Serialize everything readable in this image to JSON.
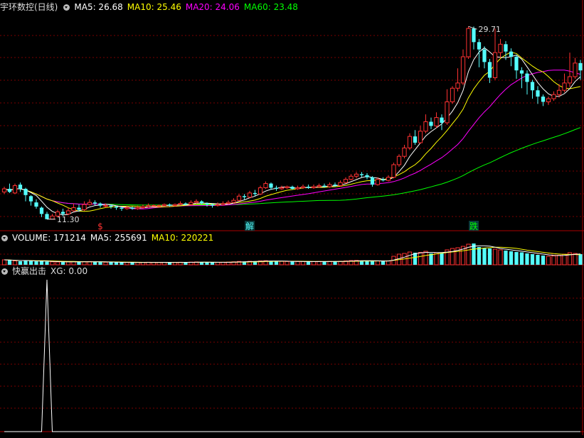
{
  "colors": {
    "up": "#ff3232",
    "down": "#54fcfc",
    "ma5": "#ffffff",
    "ma10": "#ffff00",
    "ma20": "#ff00ff",
    "ma60": "#00ff00",
    "grid": "#7a0000",
    "border": "#aa0000"
  },
  "header": {
    "title": "宇环数控(日线)",
    "ma5": "MA5: 26.68",
    "ma10": "MA10: 25.46",
    "ma20": "MA20: 24.06",
    "ma60": "MA60: 23.48"
  },
  "volume_header": {
    "label": "VOLUME: 171214",
    "ma5": "MA5: 255691",
    "ma10": "MA10: 220221"
  },
  "indicator_header": {
    "title": "快赢出击",
    "xg": "XG: 0.00"
  },
  "chart_data": [
    {
      "type": "candlestick",
      "title": "宇环数控(日线)",
      "price_range": [
        10.2,
        31.0
      ],
      "annotations": [
        {
          "text": "29.71",
          "kind": "high"
        },
        {
          "text": "11.30",
          "kind": "low"
        }
      ],
      "markers": [
        {
          "text": "$",
          "color": "#ff3232"
        },
        {
          "text": "解",
          "color": "#54fcfc"
        },
        {
          "text": "跌",
          "color": "#00ff00"
        }
      ],
      "candles": [
        [
          13.9,
          14.2,
          14.4,
          13.7
        ],
        [
          14.2,
          13.9,
          14.7,
          13.8
        ],
        [
          13.8,
          14.5,
          14.7,
          13.7
        ],
        [
          14.6,
          14.2,
          14.8,
          13.9
        ],
        [
          14.2,
          13.6,
          14.3,
          13.0
        ],
        [
          13.5,
          13.0,
          13.6,
          12.6
        ],
        [
          12.9,
          12.5,
          13.2,
          12.3
        ],
        [
          12.4,
          11.8,
          12.5,
          11.5
        ],
        [
          11.8,
          11.3,
          12.0,
          11.3
        ],
        [
          11.3,
          11.6,
          11.8,
          11.3
        ],
        [
          11.6,
          12.0,
          12.2,
          11.5
        ],
        [
          12.0,
          11.8,
          12.3,
          11.6
        ],
        [
          11.8,
          12.1,
          12.4,
          11.7
        ],
        [
          12.1,
          12.4,
          12.8,
          12.0
        ],
        [
          12.4,
          12.2,
          12.7,
          12.0
        ],
        [
          12.2,
          12.7,
          13.0,
          12.1
        ],
        [
          12.7,
          12.9,
          13.2,
          12.6
        ],
        [
          12.9,
          12.8,
          13.1,
          12.6
        ],
        [
          12.8,
          12.6,
          12.9,
          12.4
        ],
        [
          12.6,
          12.6,
          12.8,
          12.4
        ],
        [
          12.6,
          12.5,
          12.7,
          12.3
        ],
        [
          12.5,
          12.4,
          12.6,
          12.2
        ],
        [
          12.4,
          12.3,
          12.5,
          12.1
        ],
        [
          12.3,
          12.4,
          12.6,
          12.2
        ],
        [
          12.4,
          12.3,
          12.5,
          12.2
        ],
        [
          12.3,
          12.4,
          12.6,
          12.2
        ],
        [
          12.4,
          12.5,
          12.7,
          12.3
        ],
        [
          12.5,
          12.6,
          12.8,
          12.4
        ],
        [
          12.6,
          12.6,
          12.7,
          12.5
        ],
        [
          12.6,
          12.6,
          12.7,
          12.5
        ],
        [
          12.6,
          12.7,
          12.8,
          12.5
        ],
        [
          12.7,
          12.6,
          12.8,
          12.5
        ],
        [
          12.6,
          12.7,
          12.8,
          12.5
        ],
        [
          12.7,
          12.8,
          13.0,
          12.6
        ],
        [
          12.8,
          12.7,
          12.9,
          12.6
        ],
        [
          12.7,
          12.9,
          13.1,
          12.6
        ],
        [
          12.9,
          13.0,
          13.2,
          12.8
        ],
        [
          13.0,
          12.8,
          13.1,
          12.7
        ],
        [
          12.8,
          12.7,
          12.9,
          12.5
        ],
        [
          12.7,
          12.6,
          12.8,
          12.4
        ],
        [
          12.6,
          12.7,
          12.9,
          12.5
        ],
        [
          12.7,
          12.8,
          13.0,
          12.6
        ],
        [
          12.8,
          12.9,
          13.1,
          12.7
        ],
        [
          12.9,
          13.1,
          13.3,
          12.8
        ],
        [
          13.1,
          13.5,
          13.7,
          13.0
        ],
        [
          13.5,
          13.4,
          13.7,
          13.2
        ],
        [
          13.4,
          13.8,
          14.0,
          13.3
        ],
        [
          13.8,
          13.7,
          14.1,
          13.5
        ],
        [
          13.7,
          14.3,
          14.5,
          13.6
        ],
        [
          14.3,
          14.7,
          14.9,
          14.2
        ],
        [
          14.7,
          14.3,
          14.8,
          14.1
        ],
        [
          14.3,
          14.2,
          14.5,
          14.0
        ],
        [
          14.2,
          14.3,
          14.5,
          14.1
        ],
        [
          14.3,
          14.4,
          14.5,
          14.2
        ],
        [
          14.4,
          14.2,
          14.5,
          14.1
        ],
        [
          14.2,
          14.3,
          14.5,
          14.1
        ],
        [
          14.3,
          14.4,
          14.6,
          14.2
        ],
        [
          14.4,
          14.3,
          14.6,
          14.2
        ],
        [
          14.3,
          14.4,
          14.6,
          14.2
        ],
        [
          14.4,
          14.5,
          14.7,
          14.3
        ],
        [
          14.5,
          14.4,
          14.7,
          14.3
        ],
        [
          14.4,
          14.6,
          14.8,
          14.3
        ],
        [
          14.6,
          14.5,
          14.8,
          14.4
        ],
        [
          14.5,
          14.8,
          15.0,
          14.4
        ],
        [
          14.8,
          15.1,
          15.3,
          14.7
        ],
        [
          15.1,
          15.4,
          15.6,
          15.0
        ],
        [
          15.4,
          15.6,
          15.8,
          15.2
        ],
        [
          15.6,
          15.5,
          15.8,
          15.3
        ],
        [
          15.5,
          15.3,
          15.7,
          15.1
        ],
        [
          15.3,
          14.6,
          15.4,
          14.4
        ],
        [
          14.6,
          15.1,
          15.3,
          14.5
        ],
        [
          15.1,
          15.0,
          15.3,
          14.9
        ],
        [
          15.0,
          15.3,
          15.5,
          14.9
        ],
        [
          15.3,
          16.5,
          16.7,
          15.2
        ],
        [
          16.5,
          17.3,
          17.5,
          16.3
        ],
        [
          17.3,
          18.1,
          18.4,
          17.1
        ],
        [
          18.1,
          19.2,
          19.5,
          17.9
        ],
        [
          19.2,
          18.6,
          19.8,
          18.4
        ],
        [
          18.6,
          19.7,
          20.2,
          18.5
        ],
        [
          19.7,
          20.6,
          21.3,
          19.5
        ],
        [
          20.6,
          20.2,
          21.0,
          19.9
        ],
        [
          20.2,
          21.0,
          21.5,
          20.0
        ],
        [
          21.0,
          20.5,
          21.3,
          19.8
        ],
        [
          20.5,
          22.5,
          23.7,
          20.3
        ],
        [
          22.5,
          23.8,
          24.0,
          22.3
        ],
        [
          23.8,
          24.3,
          25.7,
          23.5
        ],
        [
          24.3,
          26.8,
          27.5,
          24.1
        ],
        [
          26.8,
          29.5,
          29.7,
          26.6
        ],
        [
          29.5,
          28.2,
          29.7,
          27.5
        ],
        [
          28.2,
          27.5,
          28.5,
          25.8
        ],
        [
          27.5,
          26.3,
          27.8,
          25.7
        ],
        [
          26.3,
          24.8,
          26.6,
          24.3
        ],
        [
          24.8,
          27.2,
          29.5,
          24.6
        ],
        [
          27.2,
          28.0,
          28.5,
          26.7
        ],
        [
          28.0,
          27.3,
          28.3,
          26.5
        ],
        [
          27.3,
          26.8,
          27.6,
          25.9
        ],
        [
          26.8,
          25.5,
          27.0,
          24.7
        ],
        [
          25.5,
          25.2,
          25.8,
          23.8
        ],
        [
          25.2,
          24.4,
          25.5,
          23.2
        ],
        [
          24.4,
          23.6,
          24.6,
          22.8
        ],
        [
          23.6,
          23.0,
          24.0,
          22.3
        ],
        [
          23.0,
          22.5,
          23.2,
          22.1
        ],
        [
          22.5,
          22.8,
          23.0,
          22.2
        ],
        [
          22.8,
          23.2,
          23.5,
          22.6
        ],
        [
          23.2,
          23.6,
          24.2,
          22.9
        ],
        [
          23.6,
          24.3,
          25.2,
          23.4
        ],
        [
          24.3,
          24.9,
          27.2,
          23.9
        ],
        [
          24.9,
          26.2,
          26.7,
          24.7
        ],
        [
          26.2,
          25.5,
          26.5,
          24.6
        ]
      ],
      "ma_values": {
        "MA5": 26.68,
        "MA10": 25.46,
        "MA20": 24.06,
        "MA60": 23.48
      }
    },
    {
      "type": "bar",
      "title": "VOLUME",
      "values_note": "relative volume per day",
      "values": [
        70,
        65,
        55,
        50,
        60,
        55,
        48,
        52,
        45,
        42,
        40,
        38,
        42,
        45,
        40,
        44,
        46,
        42,
        38,
        36,
        35,
        34,
        33,
        34,
        32,
        33,
        35,
        36,
        34,
        33,
        35,
        34,
        33,
        36,
        35,
        38,
        40,
        37,
        34,
        33,
        34,
        36,
        38,
        42,
        48,
        46,
        50,
        48,
        55,
        58,
        52,
        50,
        48,
        46,
        44,
        45,
        46,
        44,
        45,
        47,
        46,
        48,
        47,
        50,
        55,
        60,
        62,
        58,
        55,
        52,
        54,
        50,
        56,
        120,
        150,
        160,
        180,
        170,
        175,
        190,
        160,
        170,
        165,
        210,
        230,
        240,
        260,
        290,
        300,
        250,
        240,
        230,
        220,
        210,
        200,
        190,
        180,
        175,
        160,
        150,
        140,
        130,
        120,
        125,
        135,
        150,
        170,
        160,
        150
      ],
      "series_values": {
        "VOLUME": 171214,
        "MA5": 255691,
        "MA10": 220221
      }
    },
    {
      "type": "line",
      "title": "快赢出击",
      "series": [
        {
          "name": "XG",
          "values_note": "one spike to 1 near start, otherwise 0"
        }
      ],
      "current": "XG: 0.00",
      "spike_index": 8
    }
  ]
}
